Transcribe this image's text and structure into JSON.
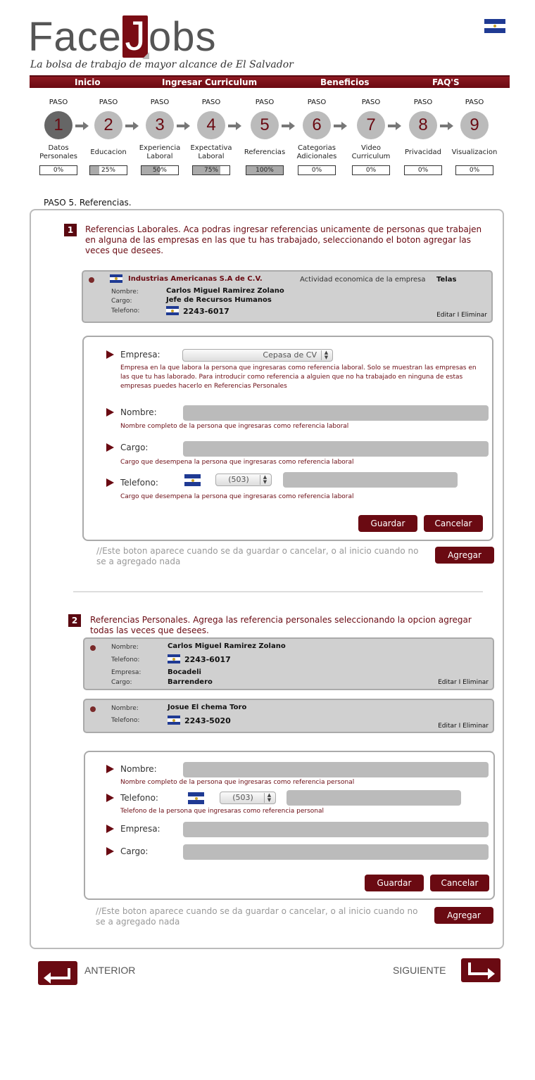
{
  "brand": {
    "logo_prefix": "Face",
    "logo_j": "J",
    "logo_suffix": "obs",
    "tagline": "La bolsa de trabajo de mayor alcance de El Salvador"
  },
  "nav": [
    "Inicio",
    "Ingresar Curriculum",
    "Beneficios",
    "FAQ'S"
  ],
  "steps": [
    {
      "paso": "PASO",
      "num": "1",
      "name": "Datos Personales",
      "progress": "0%",
      "fill": 0
    },
    {
      "paso": "PASO",
      "num": "2",
      "name": "Educacion",
      "progress": "25%",
      "fill": 25
    },
    {
      "paso": "PASO",
      "num": "3",
      "name": "Experiencia Laboral",
      "progress": "50%",
      "fill": 50
    },
    {
      "paso": "PASO",
      "num": "4",
      "name": "Expectativa Laboral",
      "progress": "75%",
      "fill": 75
    },
    {
      "paso": "PASO",
      "num": "5",
      "name": "Referencias",
      "progress": "100%",
      "fill": 100
    },
    {
      "paso": "PASO",
      "num": "6",
      "name": "Categorias Adicionales",
      "progress": "0%",
      "fill": 0
    },
    {
      "paso": "PASO",
      "num": "7",
      "name": "Video Curriculum",
      "progress": "0%",
      "fill": 0
    },
    {
      "paso": "PASO",
      "num": "8",
      "name": "Privacidad",
      "progress": "0%",
      "fill": 0
    },
    {
      "paso": "PASO",
      "num": "9",
      "name": "Visualizacion",
      "progress": "0%",
      "fill": 0
    }
  ],
  "section_title": "PASO 5. Referencias.",
  "laborales": {
    "num": "1",
    "intro": "Referencias Laborales. Aca podras ingresar referencias unicamente de personas que trabajen en alguna de las empresas en las que tu has trabajado, seleccionando el boton agregar las veces que desees.",
    "card": {
      "company": "Industrias Americanas S.A de C.V.",
      "activity_label": "Actividad economica de la empresa",
      "activity": "Telas",
      "nombre_label": "Nombre:",
      "nombre": "Carlos Miguel Ramirez Zolano",
      "cargo_label": "Cargo:",
      "cargo": "Jefe de Recursos Humanos",
      "telefono_label": "Telefono:",
      "telefono": "2243-6017",
      "actions": "Editar I Eliminar"
    },
    "form": {
      "empresa_label": "Empresa:",
      "empresa_value": "Cepasa de CV",
      "empresa_help": "Empresa en la que labora la persona que ingresaras como referencia laboral. Solo se muestran las empresas en las que tu has laborado. Para introducir como referencia a alguien que no ha trabajado en ninguna de estas empresas puedes hacerlo en Referencias Personales",
      "nombre_label": "Nombre:",
      "nombre_help": "Nombre completo de la persona que ingresaras como referencia laboral",
      "cargo_label": "Cargo:",
      "cargo_help": "Cargo que desempena la persona que ingresaras como referencia laboral",
      "telefono_label": "Telefono:",
      "telefono_code": "(503)",
      "telefono_help": "Cargo que desempena la persona que ingresaras como referencia laboral",
      "save": "Guardar",
      "cancel": "Cancelar"
    },
    "note": "//Este boton aparece cuando se da guardar o cancelar, o al inicio cuando no se a agregado nada",
    "add": "Agregar"
  },
  "personales": {
    "num": "2",
    "intro": "Referencias Personales. Agrega las referencia personales seleccionando la opcion agregar todas las veces que desees.",
    "cards": [
      {
        "nombre_label": "Nombre:",
        "nombre": "Carlos Miguel Ramirez Zolano",
        "telefono_label": "Telefono:",
        "telefono": "2243-6017",
        "empresa_label": "Empresa:",
        "empresa": "Bocadeli",
        "cargo_label": "Cargo:",
        "cargo": "Barrendero",
        "actions": "Editar I Eliminar"
      },
      {
        "nombre_label": "Nombre:",
        "nombre": "Josue El chema Toro",
        "telefono_label": "Telefono:",
        "telefono": "2243-5020",
        "actions": "Editar I Eliminar"
      }
    ],
    "form": {
      "nombre_label": "Nombre:",
      "nombre_help": "Nombre completo de la persona que ingresaras como referencia personal",
      "telefono_label": "Telefono:",
      "telefono_code": "(503)",
      "telefono_help": "Telefono de la persona que ingresaras como referencia personal",
      "empresa_label": "Empresa:",
      "cargo_label": "Cargo:",
      "save": "Guardar",
      "cancel": "Cancelar"
    },
    "note": "//Este boton aparece cuando se da guardar o cancelar, o al inicio cuando no se a agregado nada",
    "add": "Agregar"
  },
  "footer": {
    "prev": "ANTERIOR",
    "next": "SIGUIENTE"
  },
  "colors": {
    "brand": "#6a0a12",
    "card_bg": "#d0d0d0",
    "input_bg": "#bbbbbb"
  }
}
